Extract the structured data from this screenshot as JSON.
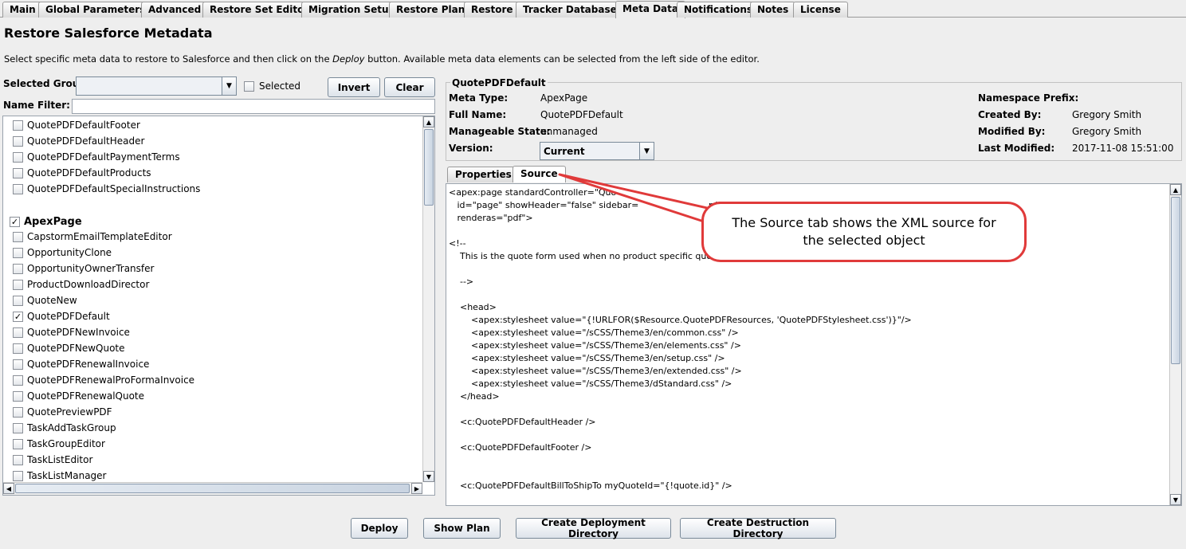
{
  "tabs": [
    "Main",
    "Global Parameters",
    "Advanced",
    "Restore Set Editor",
    "Migration Setup",
    "Restore Plan",
    "Restore",
    "Tracker Database",
    "Meta Data",
    "Notifications",
    "Notes",
    "License"
  ],
  "active_tab": "Meta Data",
  "page": {
    "title": "Restore Salesforce Metadata",
    "desc_before": "Select specific meta data to restore to Salesforce and then click on the ",
    "desc_em": "Deploy",
    "desc_after": " button. Available meta data elements can be selected from the left side of the editor."
  },
  "left": {
    "selected_group_label": "Selected Group",
    "selected_group_value": "",
    "selected_checkbox_label": "Selected",
    "invert_label": "Invert",
    "clear_label": "Clear",
    "name_filter_label": "Name Filter:",
    "name_filter_value": "",
    "items_before": [
      "QuotePDFDefaultFooter",
      "QuotePDFDefaultHeader",
      "QuotePDFDefaultPaymentTerms",
      "QuotePDFDefaultProducts",
      "QuotePDFDefaultSpecialInstructions"
    ],
    "group_name": "ApexPage",
    "items": [
      {
        "label": "CapstormEmailTemplateEditor",
        "checked": false
      },
      {
        "label": "OpportunityClone",
        "checked": false
      },
      {
        "label": "OpportunityOwnerTransfer",
        "checked": false
      },
      {
        "label": "ProductDownloadDirector",
        "checked": false
      },
      {
        "label": "QuoteNew",
        "checked": false
      },
      {
        "label": "QuotePDFDefault",
        "checked": true
      },
      {
        "label": "QuotePDFNewInvoice",
        "checked": false
      },
      {
        "label": "QuotePDFNewQuote",
        "checked": false
      },
      {
        "label": "QuotePDFRenewalInvoice",
        "checked": false
      },
      {
        "label": "QuotePDFRenewalProFormaInvoice",
        "checked": false
      },
      {
        "label": "QuotePDFRenewalQuote",
        "checked": false
      },
      {
        "label": "QuotePreviewPDF",
        "checked": false
      },
      {
        "label": "TaskAddTaskGroup",
        "checked": false
      },
      {
        "label": "TaskGroupEditor",
        "checked": false
      },
      {
        "label": "TaskListEditor",
        "checked": false
      },
      {
        "label": "TaskListManager",
        "checked": false
      }
    ]
  },
  "detail": {
    "group_title": "QuotePDFDefault",
    "meta_type_label": "Meta Type:",
    "meta_type": "ApexPage",
    "full_name_label": "Full Name:",
    "full_name": "QuotePDFDefault",
    "manageable_state_label": "Manageable State:",
    "manageable_state": "unmanaged",
    "version_label": "Version:",
    "version": "Current",
    "namespace_prefix_label": "Namespace Prefix:",
    "namespace_prefix": "",
    "created_by_label": "Created By:",
    "created_by": "Gregory Smith",
    "modified_by_label": "Modified By:",
    "modified_by": "Gregory Smith",
    "last_modified_label": "Last Modified:",
    "last_modified": "2017-11-08 15:51:00"
  },
  "subtabs": {
    "properties": "Properties",
    "source": "Source"
  },
  "source_lines": [
    "<apex:page standardController=\"Quo",
    "   id=\"page\" showHeader=\"false\" sidebar=",
    "   renderas=\"pdf\">",
    "",
    "<!--",
    "    This is the quote form used when no product specific quote",
    "",
    "    -->",
    "",
    "",
    "    <head>",
    "        <apex:stylesheet value=\"{!URLFOR($Resource.QuotePDFResources, 'QuotePDFStylesheet.css')}\"/>",
    "        <apex:stylesheet value=\"/sCSS/Theme3/en/common.css\" />",
    "        <apex:stylesheet value=\"/sCSS/Theme3/en/elements.css\" />",
    "        <apex:stylesheet value=\"/sCSS/Theme3/en/setup.css\" />",
    "        <apex:stylesheet value=\"/sCSS/Theme3/en/extended.css\" />",
    "        <apex:stylesheet value=\"/sCSS/Theme3/dStandard.css\" />",
    "    </head>",
    "",
    "    <c:QuotePDFDefaultHeader />",
    "",
    "    <c:QuotePDFDefaultFooter />",
    "",
    "",
    "    <c:QuotePDFDefaultBillToShipTo myQuoteId=\"{!quote.id}\" />"
  ],
  "source_fragment": "rdSt",
  "callout_text": "The Source tab shows the XML source for the selected object",
  "bottom_buttons": {
    "deploy": "Deploy",
    "show_plan": "Show Plan",
    "create_deployment": "Create Deployment Directory",
    "create_destruction": "Create Destruction Directory"
  },
  "colors": {
    "callout_border": "#e03a3a",
    "window_bg": "#eeeeee"
  }
}
